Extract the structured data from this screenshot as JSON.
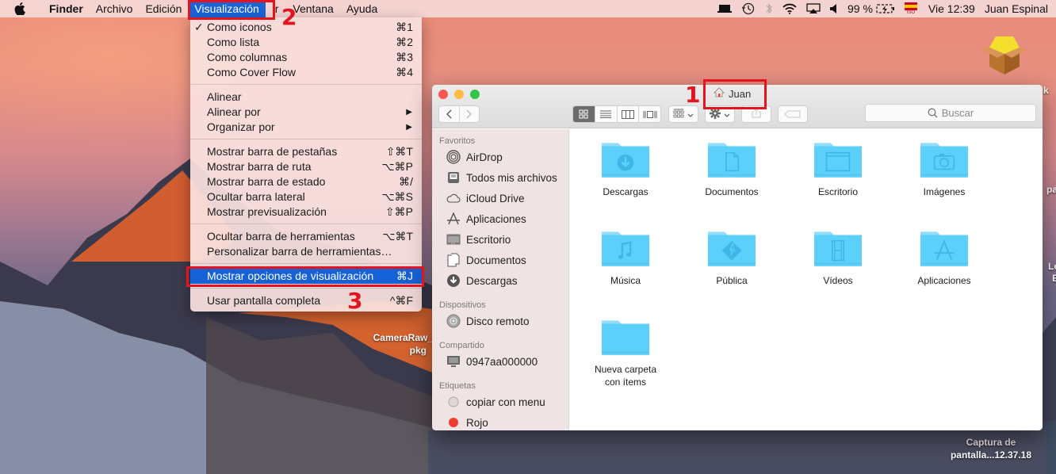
{
  "menubar": {
    "apple_icon": "apple-logo",
    "items": [
      {
        "label": "Finder",
        "bold": true
      },
      {
        "label": "Archivo"
      },
      {
        "label": "Edición"
      },
      {
        "label": "Visualización",
        "active": true
      },
      {
        "label": "Ir"
      },
      {
        "label": "Ventana"
      },
      {
        "label": "Ayuda"
      }
    ],
    "status": {
      "battery_percent": "99 %",
      "clock": "Vie 12:39",
      "user": "Juan Espinal",
      "icons": [
        "display-icon",
        "time-machine-icon",
        "bluetooth-icon",
        "wifi-icon",
        "airplay-icon",
        "volume-icon",
        "battery-charging-icon",
        "input-source-spain-flag-icon"
      ],
      "input_source_label": "ISO"
    }
  },
  "view_menu": {
    "items": [
      {
        "label": "Como iconos",
        "shortcut": "⌘1",
        "checked": true
      },
      {
        "label": "Como lista",
        "shortcut": "⌘2"
      },
      {
        "label": "Como columnas",
        "shortcut": "⌘3"
      },
      {
        "label": "Como Cover Flow",
        "shortcut": "⌘4"
      },
      {
        "separator": true
      },
      {
        "label": "Alinear"
      },
      {
        "label": "Alinear por",
        "submenu": true
      },
      {
        "label": "Organizar por",
        "submenu": true
      },
      {
        "separator": true
      },
      {
        "label": "Mostrar barra de pestañas",
        "shortcut": "⇧⌘T"
      },
      {
        "label": "Mostrar barra de ruta",
        "shortcut": "⌥⌘P"
      },
      {
        "label": "Mostrar barra de estado",
        "shortcut": "⌘/"
      },
      {
        "label": "Ocultar barra lateral",
        "shortcut": "⌥⌘S"
      },
      {
        "label": "Mostrar previsualización",
        "shortcut": "⇧⌘P"
      },
      {
        "separator": true
      },
      {
        "label": "Ocultar barra de herramientas",
        "shortcut": "⌥⌘T"
      },
      {
        "label": "Personalizar barra de herramientas…"
      },
      {
        "separator": true
      },
      {
        "label": "Mostrar opciones de visualización",
        "shortcut": "⌘J",
        "highlighted": true
      },
      {
        "separator": true
      },
      {
        "label": "Usar pantalla completa",
        "shortcut": "^⌘F"
      }
    ],
    "check_glyph": "✓",
    "submenu_glyph": "▶"
  },
  "annotations": {
    "one": "1",
    "two": "2",
    "three": "3",
    "color": "#e3141d"
  },
  "finder": {
    "title": "Juan",
    "search_placeholder": "Buscar",
    "toolbar": {
      "back": "‹",
      "forward": "›",
      "view_modes": [
        "icon-view",
        "list-view",
        "column-view",
        "cover-flow-view"
      ],
      "selected_view": "icon-view"
    },
    "sidebar": {
      "sections": [
        {
          "title": "Favoritos",
          "items": [
            {
              "label": "AirDrop",
              "icon": "airdrop-icon"
            },
            {
              "label": "Todos mis archivos",
              "icon": "all-files-icon"
            },
            {
              "label": "iCloud Drive",
              "icon": "cloud-icon"
            },
            {
              "label": "Aplicaciones",
              "icon": "applications-icon"
            },
            {
              "label": "Escritorio",
              "icon": "desktop-icon"
            },
            {
              "label": "Documentos",
              "icon": "documents-icon"
            },
            {
              "label": "Descargas",
              "icon": "downloads-icon"
            }
          ]
        },
        {
          "title": "Dispositivos",
          "items": [
            {
              "label": "Disco remoto",
              "icon": "disc-icon"
            }
          ]
        },
        {
          "title": "Compartido",
          "items": [
            {
              "label": "0947aa000000",
              "icon": "computer-icon"
            }
          ]
        },
        {
          "title": "Etiquetas",
          "items": [
            {
              "label": "copiar con menu",
              "icon": "tag-gray-icon"
            },
            {
              "label": "Rojo",
              "icon": "tag-red-icon"
            }
          ]
        }
      ]
    },
    "folders": [
      {
        "label": "Descargas",
        "glyph": "download"
      },
      {
        "label": "Documentos",
        "glyph": "document"
      },
      {
        "label": "Escritorio",
        "glyph": "window"
      },
      {
        "label": "Imágenes",
        "glyph": "camera"
      },
      {
        "label": "Música",
        "glyph": "music"
      },
      {
        "label": "Pública",
        "glyph": "public"
      },
      {
        "label": "Vídeos",
        "glyph": "film"
      },
      {
        "label": "Aplicaciones",
        "glyph": "app"
      },
      {
        "label": "Nueva carpeta con ítems",
        "line1": "Nueva carpeta",
        "line2": "con ítems",
        "glyph": "none"
      }
    ],
    "folder_color": "#5ad0fb"
  },
  "desktop": {
    "items": [
      {
        "label_line1": "CameraRaw_",
        "label_line2": "pkg"
      },
      {
        "label_line1": "Captura de",
        "label_line2": "pantalla...12.37.18"
      }
    ],
    "edge_fragments": [
      "k",
      "pa",
      "Lo",
      "E"
    ]
  }
}
